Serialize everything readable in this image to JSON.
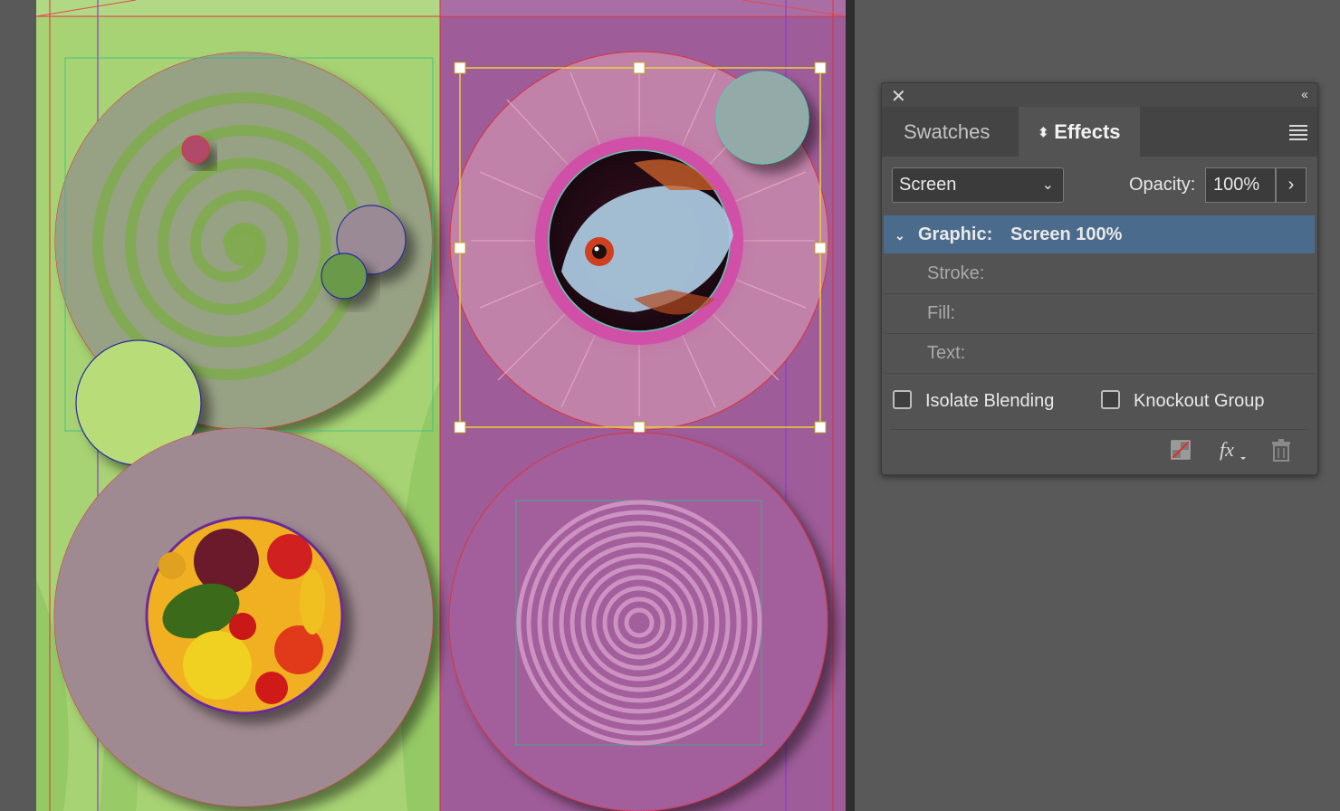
{
  "panel": {
    "tabs": [
      {
        "label": "Swatches",
        "active": false
      },
      {
        "label": "Effects",
        "active": true
      }
    ],
    "blend_mode": "Screen",
    "opacity_label": "Opacity:",
    "opacity_value": "100%",
    "target": {
      "label": "Graphic:",
      "value": "Screen 100%"
    },
    "attributes": [
      {
        "label": "Stroke:"
      },
      {
        "label": "Fill:"
      },
      {
        "label": "Text:"
      }
    ],
    "isolate_blending": {
      "label": "Isolate Blending",
      "checked": false
    },
    "knockout_group": {
      "label": "Knockout Group",
      "checked": false
    },
    "footer_icons": [
      "clear-effects-icon",
      "fx-icon",
      "trash-icon"
    ]
  },
  "colors": {
    "page_green": "#a7d374",
    "page_purple": "#9e5c98",
    "selection_row": "#4b6b8c",
    "panel_bg": "#535353",
    "pasteboard": "#595959"
  }
}
